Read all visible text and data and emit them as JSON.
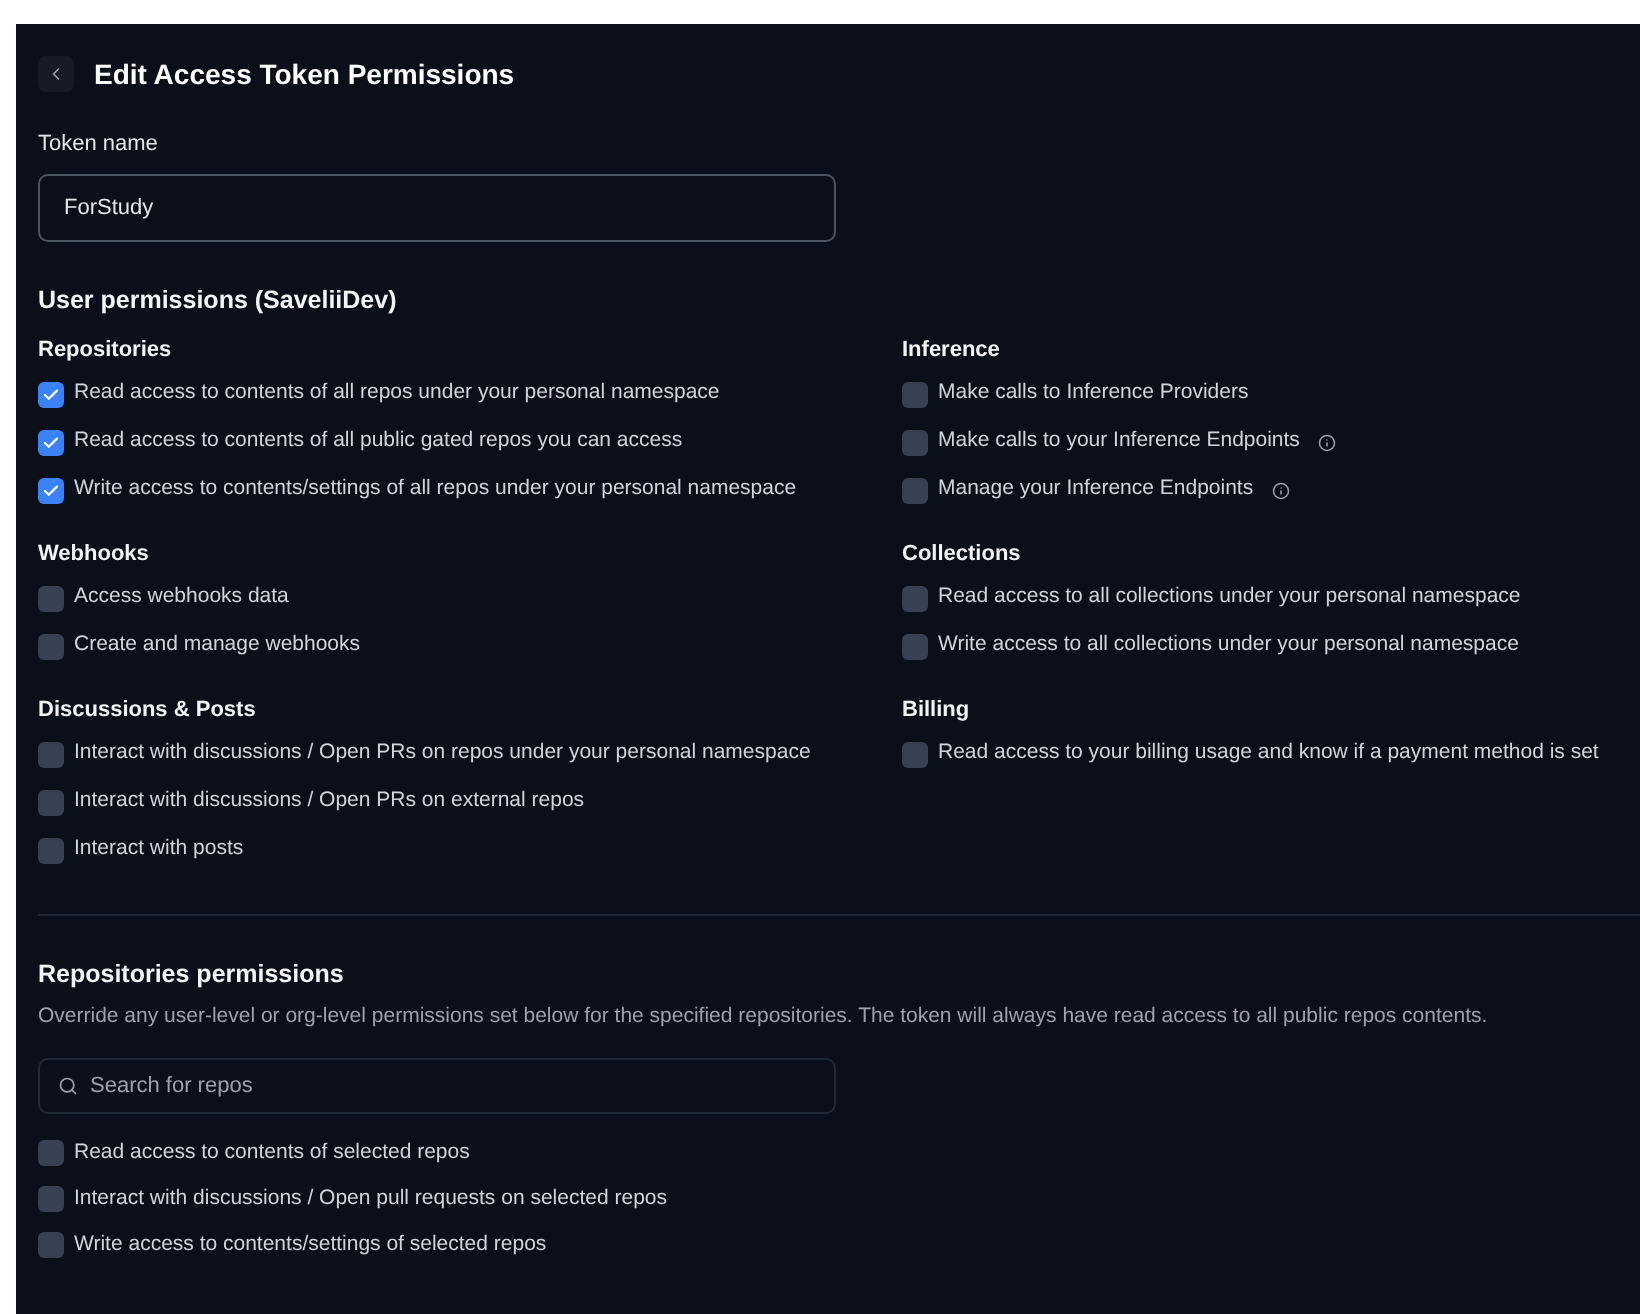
{
  "header": {
    "title": "Edit Access Token Permissions"
  },
  "token_name": {
    "label": "Token name",
    "value": "ForStudy"
  },
  "user_permissions": {
    "title": "User permissions (SaveliiDev)",
    "columns": [
      [
        {
          "title": "Repositories",
          "items": [
            {
              "label": "Read access to contents of all repos under your personal namespace",
              "checked": true,
              "info": false
            },
            {
              "label": "Read access to contents of all public gated repos you can access",
              "checked": true,
              "info": false
            },
            {
              "label": "Write access to contents/settings of all repos under your personal namespace",
              "checked": true,
              "info": false
            }
          ]
        },
        {
          "title": "Webhooks",
          "items": [
            {
              "label": "Access webhooks data",
              "checked": false,
              "info": false
            },
            {
              "label": "Create and manage webhooks",
              "checked": false,
              "info": false
            }
          ]
        },
        {
          "title": "Discussions & Posts",
          "items": [
            {
              "label": "Interact with discussions / Open PRs on repos under your personal namespace",
              "checked": false,
              "info": false
            },
            {
              "label": "Interact with discussions / Open PRs on external repos",
              "checked": false,
              "info": false
            },
            {
              "label": "Interact with posts",
              "checked": false,
              "info": false
            }
          ]
        }
      ],
      [
        {
          "title": "Inference",
          "items": [
            {
              "label": "Make calls to Inference Providers",
              "checked": false,
              "info": false
            },
            {
              "label": "Make calls to your Inference Endpoints",
              "checked": false,
              "info": true
            },
            {
              "label": "Manage your Inference Endpoints",
              "checked": false,
              "info": true
            }
          ]
        },
        {
          "title": "Collections",
          "items": [
            {
              "label": "Read access to all collections under your personal namespace",
              "checked": false,
              "info": false
            },
            {
              "label": "Write access to all collections under your personal namespace",
              "checked": false,
              "info": false
            }
          ]
        },
        {
          "title": "Billing",
          "items": [
            {
              "label": "Read access to your billing usage and know if a payment method is set",
              "checked": false,
              "info": false
            }
          ]
        }
      ]
    ]
  },
  "repositories_permissions": {
    "title": "Repositories permissions",
    "description": "Override any user-level or org-level permissions set below for the specified repositories. The token will always have read access to all public repos contents.",
    "search": {
      "placeholder": "Search for repos"
    },
    "items": [
      {
        "label": "Read access to contents of selected repos",
        "checked": false
      },
      {
        "label": "Interact with discussions / Open pull requests on selected repos",
        "checked": false
      },
      {
        "label": "Write access to contents/settings of selected repos",
        "checked": false
      }
    ]
  }
}
